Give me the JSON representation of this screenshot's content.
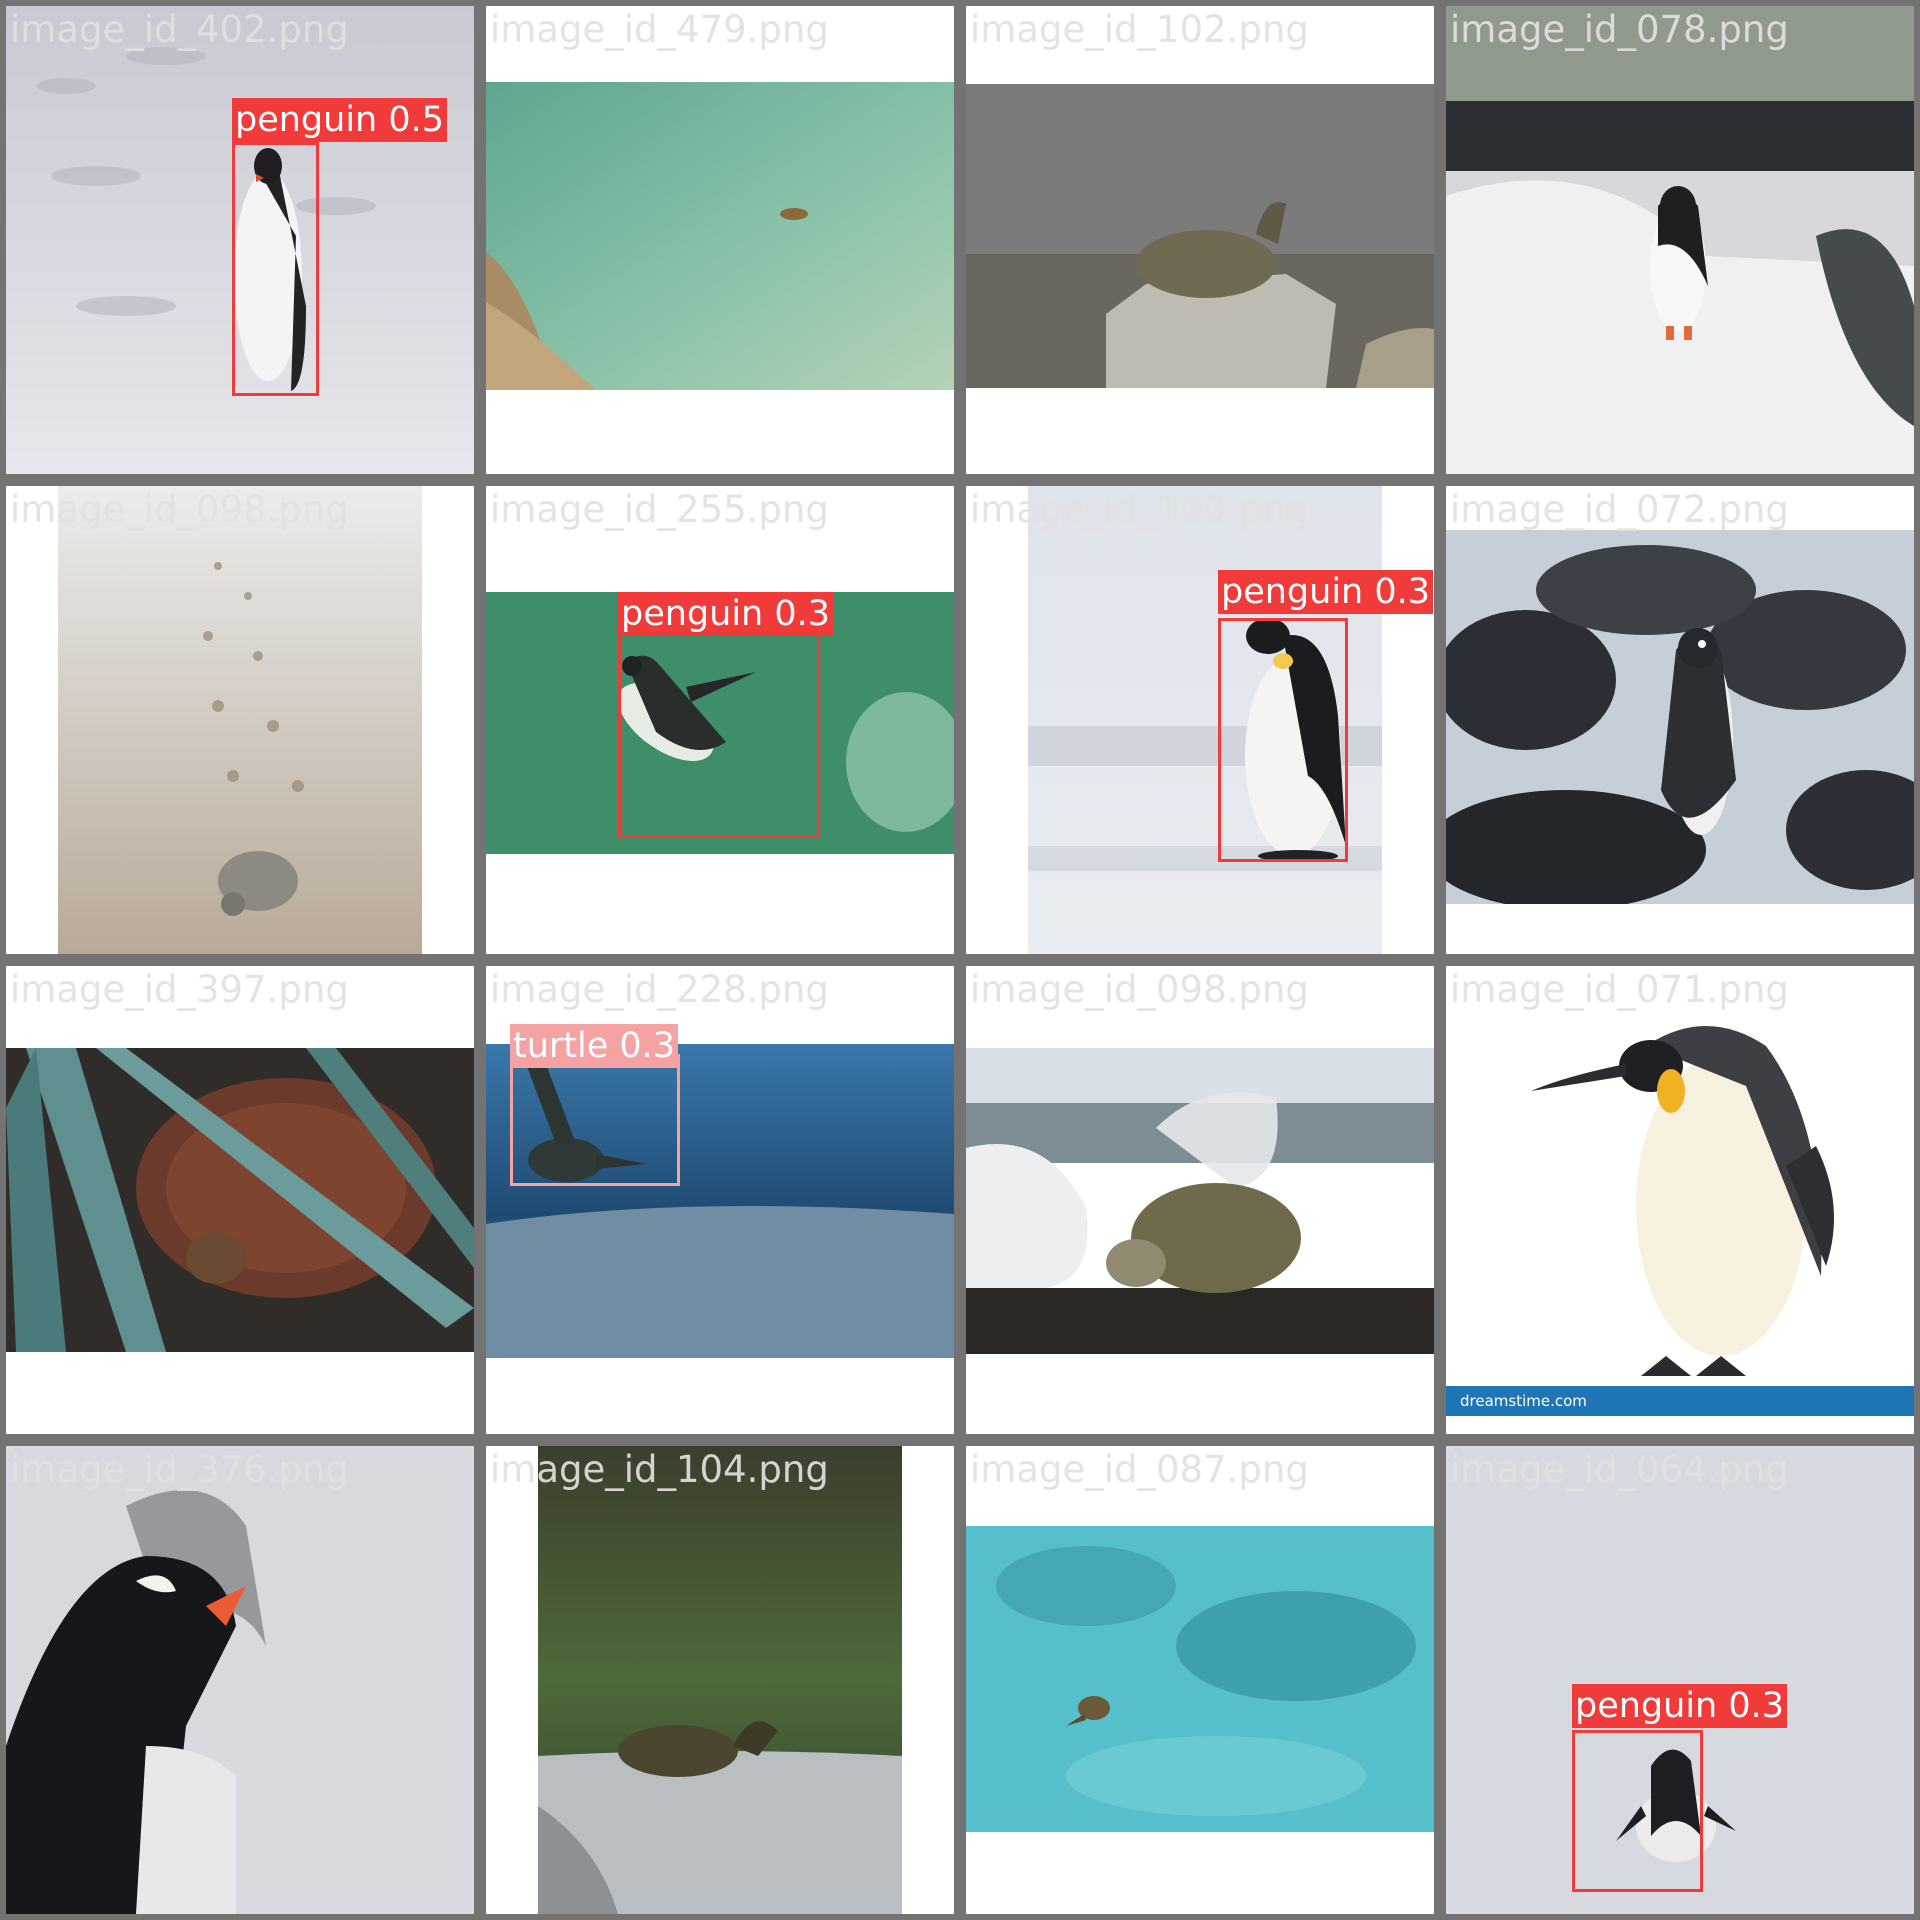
{
  "tiles": [
    {
      "filename": "image_id_402.png",
      "scene": "snow-penguin-small",
      "detections": [
        {
          "label": "penguin 0.5",
          "kind": "penguin"
        }
      ]
    },
    {
      "filename": "image_id_479.png",
      "scene": "green-water-turtle",
      "detections": []
    },
    {
      "filename": "image_id_102.png",
      "scene": "turtle-on-rock",
      "detections": []
    },
    {
      "filename": "image_id_078.png",
      "scene": "snow-penguin-walking",
      "detections": []
    },
    {
      "filename": "image_id_098.png",
      "scene": "beach-hatchling",
      "detections": []
    },
    {
      "filename": "image_id_255.png",
      "scene": "penguin-swimming",
      "detections": [
        {
          "label": "penguin 0.3",
          "kind": "penguin"
        }
      ]
    },
    {
      "filename": "image_id_100.png",
      "scene": "emperor-penguin-ice",
      "detections": [
        {
          "label": "penguin 0.3",
          "kind": "penguin"
        }
      ]
    },
    {
      "filename": "image_id_072.png",
      "scene": "penguin-on-rocks",
      "detections": []
    },
    {
      "filename": "image_id_397.png",
      "scene": "turtle-in-grass",
      "detections": []
    },
    {
      "filename": "image_id_228.png",
      "scene": "turtle-underwater",
      "detections": [
        {
          "label": "turtle 0.3",
          "kind": "turtle"
        }
      ]
    },
    {
      "filename": "image_id_098.png",
      "scene": "sea-turtle-surf",
      "detections": []
    },
    {
      "filename": "image_id_071.png",
      "scene": "king-penguin-white",
      "detections": [],
      "watermark": "dreamstime.com"
    },
    {
      "filename": "image_id_376.png",
      "scene": "gentoo-closeup",
      "detections": []
    },
    {
      "filename": "image_id_104.png",
      "scene": "slider-turtle-rock",
      "detections": []
    },
    {
      "filename": "image_id_087.png",
      "scene": "turtle-turquoise-water",
      "detections": []
    },
    {
      "filename": "image_id_064.png",
      "scene": "penguin-sliding-snow",
      "detections": [
        {
          "label": "penguin 0.3",
          "kind": "penguin"
        }
      ]
    }
  ],
  "colors": {
    "grid_background": "#737373",
    "detection_penguin": "#f13a3a",
    "detection_turtle": "#f5a2a2",
    "filename_text": "#e1e1e1"
  }
}
